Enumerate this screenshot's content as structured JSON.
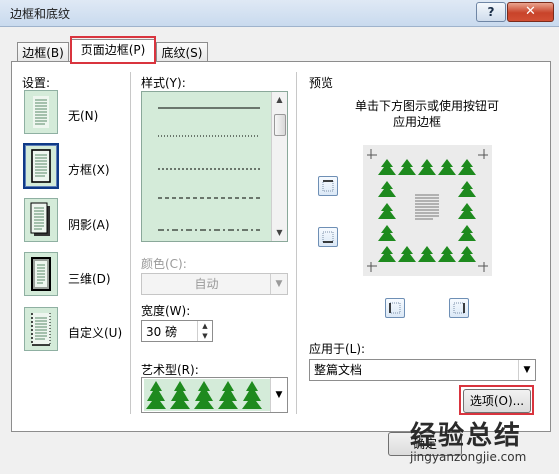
{
  "window": {
    "title": "边框和底纹",
    "help_label": "?",
    "close_label": "✕"
  },
  "tabs": [
    {
      "label": "边框(B)",
      "active": false
    },
    {
      "label": "页面边框(P)",
      "active": true
    },
    {
      "label": "底纹(S)",
      "active": false
    }
  ],
  "settings": {
    "label": "设置:",
    "items": [
      {
        "label": "无(N)",
        "icon": "no-border-icon",
        "selected": false
      },
      {
        "label": "方框(X)",
        "icon": "box-border-icon",
        "selected": true
      },
      {
        "label": "阴影(A)",
        "icon": "shadow-border-icon",
        "selected": false
      },
      {
        "label": "三维(D)",
        "icon": "3d-border-icon",
        "selected": false
      },
      {
        "label": "自定义(U)",
        "icon": "custom-border-icon",
        "selected": false
      }
    ]
  },
  "style": {
    "label": "样式(Y):",
    "line_styles": [
      "solid",
      "dotted",
      "dashed-fine",
      "dashed",
      "dash-dot",
      "dash-dot-dot"
    ]
  },
  "color": {
    "label": "颜色(C):",
    "value": "自动"
  },
  "width": {
    "label": "宽度(W):",
    "value": "30 磅"
  },
  "art": {
    "label": "艺术型(R):",
    "icon": "christmas-tree-icon"
  },
  "preview": {
    "label": "预览",
    "hint_line1": "单击下方图示或使用按钮可",
    "hint_line2": "应用边框"
  },
  "apply_to": {
    "label": "应用于(L):",
    "value": "整篇文档"
  },
  "buttons": {
    "options": "选项(O)...",
    "ok": "确定"
  },
  "watermark": {
    "brand": "经验总结",
    "url": "jingyanzongjie.com"
  },
  "colors": {
    "highlight_red": "#d9343e",
    "tree_green": "#1e8a1e",
    "setting_bg": "#d4ebd9"
  }
}
